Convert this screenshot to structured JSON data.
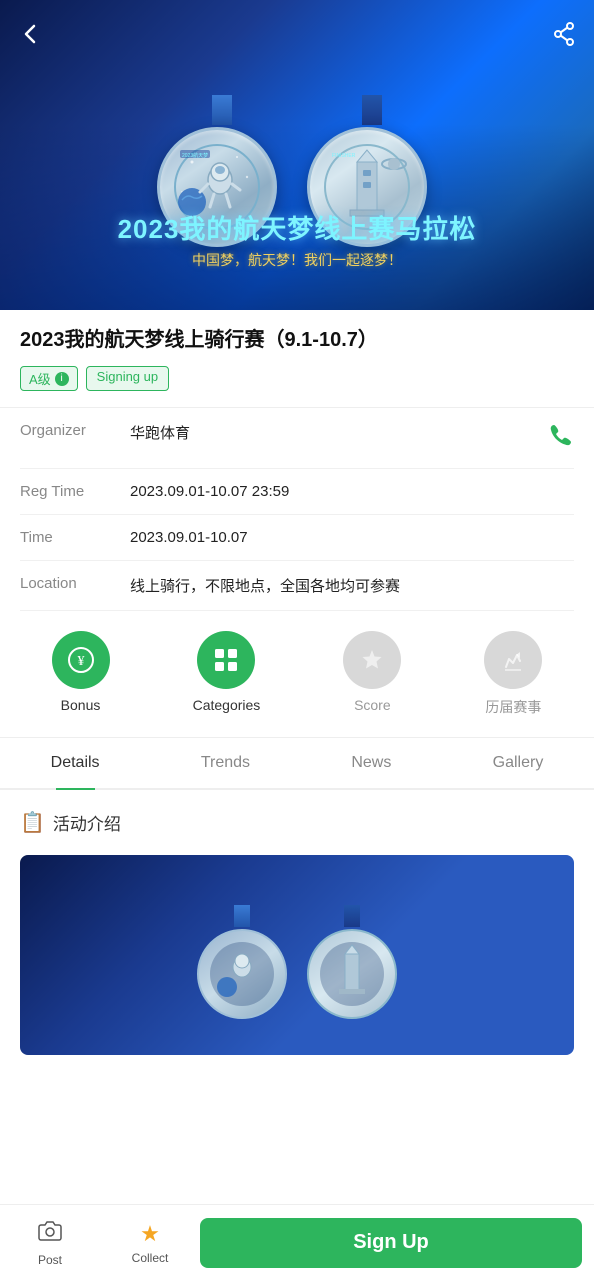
{
  "hero": {
    "title": "2023我的航天梦线上赛马拉松",
    "subtitle": "中国梦，航天梦！我们一起逐梦！"
  },
  "nav": {
    "back_label": "←",
    "share_label": "share"
  },
  "event": {
    "title": "2023我的航天梦线上骑行赛（9.1-10.7）",
    "badge_level": "A级",
    "badge_status": "Signing up",
    "organizer_label": "Organizer",
    "organizer_value": "华跑体育",
    "reg_time_label": "Reg Time",
    "reg_time_value": "2023.09.01-10.07 23:59",
    "time_label": "Time",
    "time_value": "2023.09.01-10.07",
    "location_label": "Location",
    "location_value": "线上骑行，不限地点，全国各地均可参赛"
  },
  "icons": [
    {
      "id": "bonus",
      "label": "Bonus",
      "color": "green",
      "icon": "¥"
    },
    {
      "id": "categories",
      "label": "Categories",
      "color": "green",
      "icon": "⊞"
    },
    {
      "id": "score",
      "label": "Score",
      "color": "gray",
      "icon": "★"
    },
    {
      "id": "history",
      "label": "历届赛事",
      "color": "gray",
      "icon": "🏆"
    }
  ],
  "tabs": [
    {
      "id": "details",
      "label": "Details",
      "active": true
    },
    {
      "id": "trends",
      "label": "Trends",
      "active": false
    },
    {
      "id": "news",
      "label": "News",
      "active": false
    },
    {
      "id": "gallery",
      "label": "Gallery",
      "active": false
    }
  ],
  "activity_intro": {
    "icon": "📋",
    "label": "活动介绍"
  },
  "bottom": {
    "post_label": "Post",
    "collect_label": "Collect",
    "signup_label": "Sign Up"
  }
}
